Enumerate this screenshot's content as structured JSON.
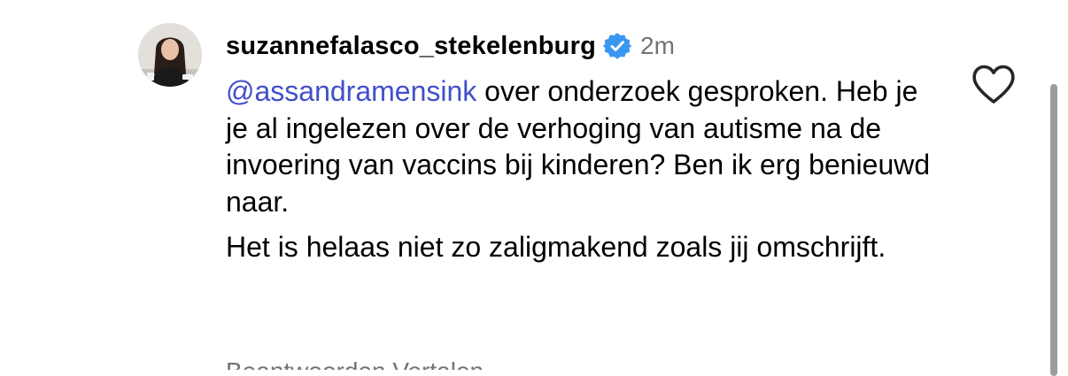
{
  "comment": {
    "avatar": "profile-photo",
    "username": "suzannefalasco_stekelenburg",
    "verified_icon": "verified-badge-icon",
    "verified_color": "#3897f0",
    "timestamp": "2m",
    "mention": "@assandramensink",
    "text_line1_rest": " over onderzoek gesproken. Heb je je al ingelezen over de verhoging van autisme na de invoering van vaccins bij kinderen? Ben ik erg benieuwd naar.",
    "text_paragraph2": "Het is helaas niet zo zaligmakend zoals jij omschrijft.",
    "like_icon": "heart-outline-icon",
    "mention_color": "#4150c8"
  },
  "footer_partial": "Beantwoorden   Vertalen"
}
